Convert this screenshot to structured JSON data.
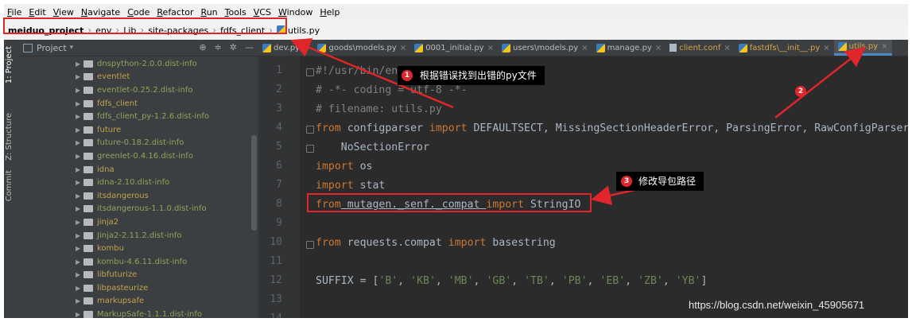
{
  "menu": [
    "File",
    "Edit",
    "View",
    "Navigate",
    "Code",
    "Refactor",
    "Run",
    "Tools",
    "VCS",
    "Window",
    "Help"
  ],
  "breadcrumb": [
    "meiduo_project",
    "env",
    "Lib",
    "site-packages",
    "fdfs_client",
    "utils.py"
  ],
  "tool_labels": [
    "1: Project",
    "Z: Structure",
    "Commit"
  ],
  "project": {
    "title": "Project",
    "items": [
      {
        "name": "dnspython-2.0.0.dist-info",
        "kind": "other"
      },
      {
        "name": "eventlet",
        "kind": "pkg"
      },
      {
        "name": "eventlet-0.25.2.dist-info",
        "kind": "other"
      },
      {
        "name": "fdfs_client",
        "kind": "pkg"
      },
      {
        "name": "fdfs_client_py-1.2.6.dist-info",
        "kind": "other"
      },
      {
        "name": "future",
        "kind": "pkg"
      },
      {
        "name": "future-0.18.2.dist-info",
        "kind": "other"
      },
      {
        "name": "greenlet-0.4.16.dist-info",
        "kind": "other"
      },
      {
        "name": "idna",
        "kind": "pkg"
      },
      {
        "name": "idna-2.10.dist-info",
        "kind": "other"
      },
      {
        "name": "itsdangerous",
        "kind": "pkg"
      },
      {
        "name": "itsdangerous-1.1.0.dist-info",
        "kind": "other"
      },
      {
        "name": "jinja2",
        "kind": "pkg"
      },
      {
        "name": "Jinja2-2.11.2.dist-info",
        "kind": "other"
      },
      {
        "name": "kombu",
        "kind": "pkg"
      },
      {
        "name": "kombu-4.6.11.dist-info",
        "kind": "other"
      },
      {
        "name": "libfuturize",
        "kind": "pkg"
      },
      {
        "name": "libpasteurize",
        "kind": "pkg"
      },
      {
        "name": "markupsafe",
        "kind": "pkg"
      },
      {
        "name": "MarkupSafe-1.1.1.dist-info",
        "kind": "other"
      }
    ]
  },
  "tabs": [
    {
      "label": "dev.py",
      "active": false,
      "orange": false
    },
    {
      "label": "goods\\models.py",
      "active": false,
      "orange": false
    },
    {
      "label": "0001_initial.py",
      "active": false,
      "orange": false
    },
    {
      "label": "users\\models.py",
      "active": false,
      "orange": false
    },
    {
      "label": "manage.py",
      "active": false,
      "orange": false
    },
    {
      "label": "client.conf",
      "active": false,
      "orange": true
    },
    {
      "label": "fastdfs\\__init__.py",
      "active": false,
      "orange": true
    },
    {
      "label": "utils.py",
      "active": true,
      "orange": true
    }
  ],
  "line_numbers": [
    "1",
    "2",
    "3",
    "4",
    "5",
    "6",
    "7",
    "8",
    "9",
    "10",
    "11",
    "12",
    "13",
    "14"
  ],
  "code": {
    "l1": "#!/usr/bin/env python",
    "l2": "# -*- coding = utf-8 -*-",
    "l3": "# filename: utils.py",
    "l4_kw1": "from",
    "l4_mod": " configparser ",
    "l4_kw2": "import",
    "l4_rest": " DEFAULTSECT, MissingSectionHeaderError, ParsingError, RawConfigParser,",
    "l5": "    NoSectionError",
    "l6_kw": "import",
    "l6_rest": " os",
    "l7_kw": "import",
    "l7_rest": " stat",
    "l8_kw1": "from",
    "l8_mod": " mutagen._senf._compat ",
    "l8_kw2": "import",
    "l8_rest": " StringIO",
    "l10_kw1": "from",
    "l10_mod": " requests.compat ",
    "l10_kw2": "import",
    "l10_rest": " basestring",
    "l12_pre": "SUFFIX = [",
    "l12_items": [
      "'B'",
      "'KB'",
      "'MB'",
      "'GB'",
      "'TB'",
      "'PB'",
      "'EB'",
      "'ZB'",
      "'YB'"
    ],
    "l12_post": "]"
  },
  "annotations": {
    "a1": {
      "num": "1",
      "text": "根据错误找到出错的py文件"
    },
    "a2": {
      "num": "2"
    },
    "a3": {
      "num": "3",
      "text": "修改导包路径"
    }
  },
  "watermark": "https://blog.csdn.net/weixin_45905671",
  "colors": {
    "annotation_red": "#e0262b",
    "keyword": "#cc7832",
    "comment": "#808080",
    "string": "#6a8759"
  }
}
